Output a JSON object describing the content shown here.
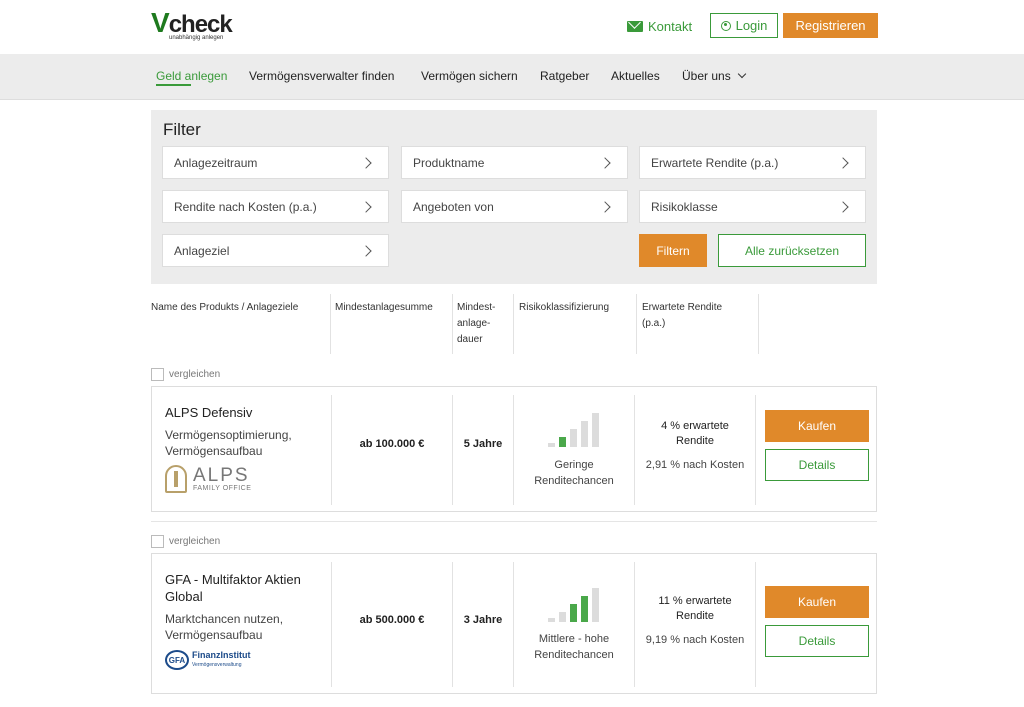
{
  "header": {
    "logo_text": "check",
    "logo_v": "V",
    "logo_tagline": "unabhängig anlegen",
    "kontakt": "Kontakt",
    "login": "Login",
    "register": "Registrieren"
  },
  "nav": {
    "items": [
      {
        "label": "Geld anlegen",
        "active": true
      },
      {
        "label": "Vermögensverwalter finden"
      },
      {
        "label": "Vermögen sichern"
      },
      {
        "label": "Ratgeber"
      },
      {
        "label": "Aktuelles"
      },
      {
        "label": "Über uns"
      }
    ]
  },
  "filter": {
    "title": "Filter",
    "fields": [
      "Anlagezeitraum",
      "Produktname",
      "Erwartete Rendite (p.a.)",
      "Rendite nach Kosten (p.a.)",
      "Angeboten von",
      "Risikoklasse",
      "Anlageziel"
    ],
    "submit": "Filtern",
    "reset": "Alle zurücksetzen"
  },
  "table": {
    "columns": [
      "Name des Produkts / Anlageziele",
      "Mindestanlagesumme",
      "Mindest-",
      "anlage-",
      "dauer",
      "Risikoklassifizierung",
      "Erwartete Rendite",
      "(p.a.)"
    ]
  },
  "compare_label": "vergleichen",
  "products": [
    {
      "name": "ALPS Defensiv",
      "goal_1": "Vermögensoptimierung,",
      "goal_2": "Vermögensaufbau",
      "min_sum": "ab 100.000 €",
      "min_duration": "5 Jahre",
      "risk_level": 2,
      "risk_1": "Geringe",
      "risk_2": "Renditechancen",
      "return_1": "4 % erwartete",
      "return_2": "Rendite",
      "after_cost": "2,91 % nach Kosten",
      "buy": "Kaufen",
      "details": "Details",
      "provider_logo_big": "ALPS",
      "provider_logo_small": "FAMILY OFFICE"
    },
    {
      "name_1": "GFA - Multifaktor Aktien",
      "name_2": "Global",
      "goal_1": "Marktchancen nutzen,",
      "goal_2": "Vermögensaufbau",
      "min_sum": "ab 500.000 €",
      "min_duration": "3 Jahre",
      "risk_level": 4,
      "risk_1": "Mittlere - hohe",
      "risk_2": "Renditechancen",
      "return_1": "11 % erwartete",
      "return_2": "Rendite",
      "after_cost": "9,19 % nach Kosten",
      "buy": "Kaufen",
      "details": "Details",
      "provider_badge": "GFA",
      "provider_name": "FinanzInstitut",
      "provider_sub": "Vermögensverwaltung"
    }
  ],
  "colors": {
    "accent_green": "#3a9a3a",
    "accent_orange": "#e0892a"
  }
}
